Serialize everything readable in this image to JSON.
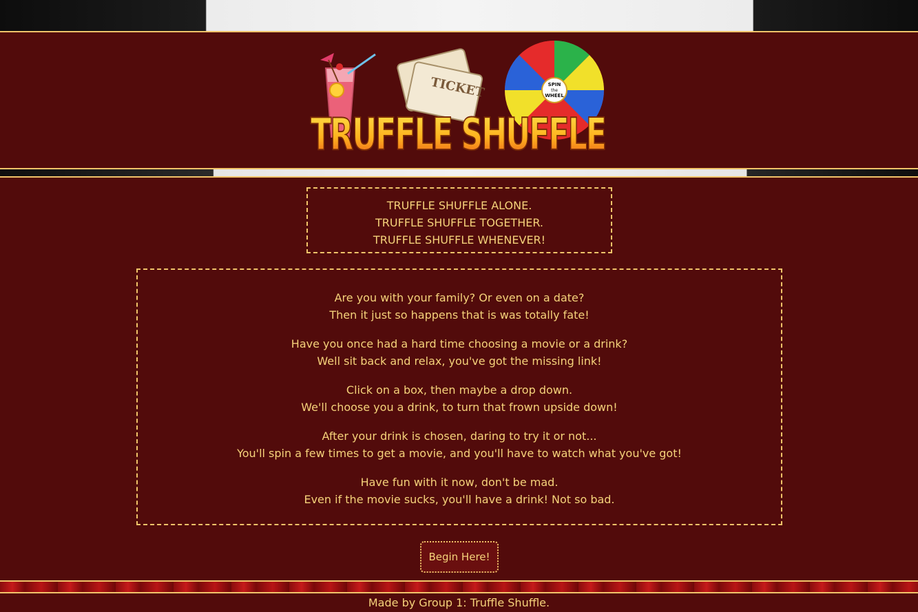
{
  "tagline": {
    "lines": [
      "TRUFFLE SHUFFLE ALONE.",
      "TRUFFLE SHUFFLE TOGETHER.",
      "TRUFFLE SHUFFLE WHENEVER!"
    ]
  },
  "poem": {
    "stanzas": [
      {
        "line1": "Are you with your family? Or even on a date?",
        "line2": "Then it just so happens that is was totally fate!"
      },
      {
        "line1": "Have you once had a hard time choosing a movie or a drink?",
        "line2": "Well sit back and relax, you've got the missing link!"
      },
      {
        "line1": "Click on a box, then maybe a drop down.",
        "line2": "We'll choose you a drink, to turn that frown upside down!"
      },
      {
        "line1": "After your drink is chosen, daring to try it or not...",
        "line2": "You'll spin a few times to get a movie, and you'll have to watch what you've got!"
      },
      {
        "line1": "Have fun with it now, don't be mad.",
        "line2": "Even if the movie sucks, you'll have a drink! Not so bad."
      }
    ]
  },
  "begin_button": "Begin Here!",
  "footer": "Made by Group 1: Truffle Shuffle.",
  "logo": {
    "title": "TRUFFLE SHUFFLE",
    "wheel_text": [
      "SPIN",
      "the",
      "WHEEL"
    ],
    "ticket_text": "TICKET",
    "icons": [
      "cocktail-icon",
      "cinema-tickets-icon",
      "spin-wheel-icon"
    ]
  },
  "colors": {
    "background": "#520b0b",
    "accent": "#f1c46a",
    "text": "#f5d27a"
  }
}
